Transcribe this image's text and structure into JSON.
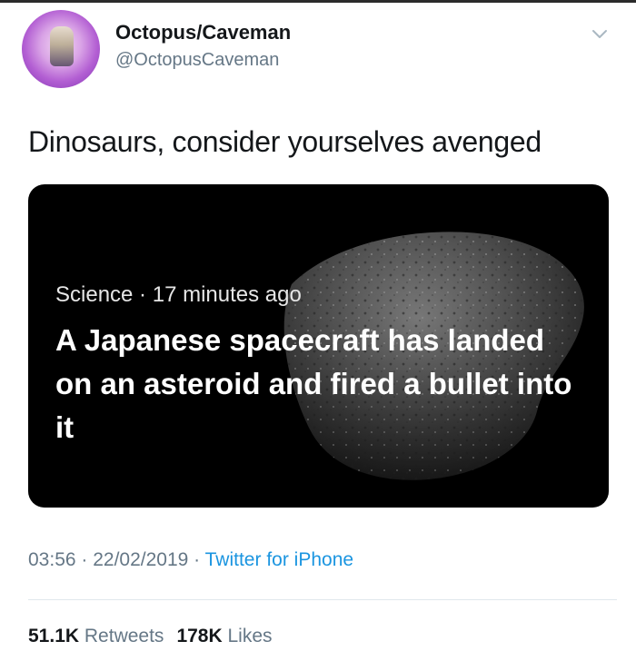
{
  "user": {
    "display_name": "Octopus/Caveman",
    "handle": "@OctopusCaveman"
  },
  "tweet": {
    "text": "Dinosaurs, consider yourselves avenged"
  },
  "card": {
    "category": "Science",
    "separator": " · ",
    "time_ago": "17 minutes ago",
    "headline": "A Japanese spacecraft has landed on an asteroid and fired a bullet into it"
  },
  "meta": {
    "time": "03:56",
    "date": "22/02/2019",
    "separator": " · ",
    "source": "Twitter for iPhone"
  },
  "stats": {
    "retweets_count": "51.1K",
    "retweets_label": "Retweets",
    "likes_count": "178K",
    "likes_label": "Likes"
  },
  "icons": {
    "caret": "chevron-down-icon"
  },
  "colors": {
    "link": "#1b95e0",
    "muted": "#657786",
    "text": "#14171a",
    "card_bg": "#000000"
  }
}
